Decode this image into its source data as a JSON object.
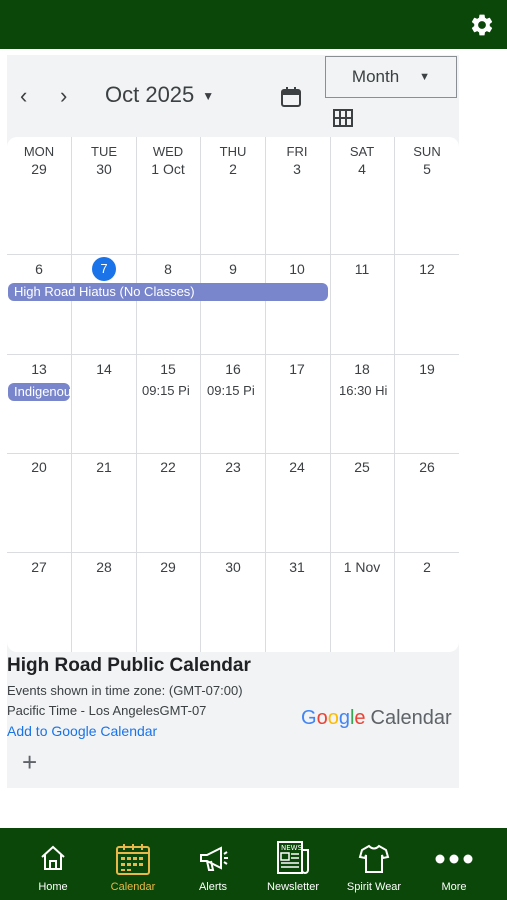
{
  "header": {
    "settings_icon": "gear-icon"
  },
  "calendar": {
    "title": "Oct 2025",
    "view_label": "Month",
    "weekdays": [
      "MON",
      "TUE",
      "WED",
      "THU",
      "FRI",
      "SAT",
      "SUN"
    ],
    "weeks": [
      [
        "29",
        "30",
        "1 Oct",
        "2",
        "3",
        "4",
        "5"
      ],
      [
        "6",
        "7",
        "8",
        "9",
        "10",
        "11",
        "12"
      ],
      [
        "13",
        "14",
        "15",
        "16",
        "17",
        "18",
        "19"
      ],
      [
        "20",
        "21",
        "22",
        "23",
        "24",
        "25",
        "26"
      ],
      [
        "27",
        "28",
        "29",
        "30",
        "31",
        "1 Nov",
        "2"
      ]
    ],
    "events": {
      "hiatus": "High Road Hiatus (No Classes)",
      "indigenous": "Indigenous",
      "wed15": "09:15 Pi",
      "thu16": "09:15 Pi",
      "sat18": "16:30 Hi"
    }
  },
  "footer": {
    "title": "High Road Public Calendar",
    "tz_line1": "Events shown in time zone: (GMT-07:00)",
    "tz_line2": "Pacific Time - Los AngelesGMT-07",
    "add_link": "Add to Google Calendar",
    "google_word": "Google",
    "calendar_word": "Calendar"
  },
  "bottom_nav": {
    "items": [
      {
        "label": "Home",
        "icon": "home-icon"
      },
      {
        "label": "Calendar",
        "icon": "calendar-icon"
      },
      {
        "label": "Alerts",
        "icon": "megaphone-icon"
      },
      {
        "label": "Newsletter",
        "icon": "newspaper-icon"
      },
      {
        "label": "Spirit Wear",
        "icon": "shirt-icon"
      },
      {
        "label": "More",
        "icon": "more-dots-icon"
      }
    ]
  },
  "colors": {
    "brand_green": "#0b4708",
    "active_tab": "#e8b94a",
    "event_purple": "#7986cb",
    "today_blue": "#1a73e8"
  }
}
